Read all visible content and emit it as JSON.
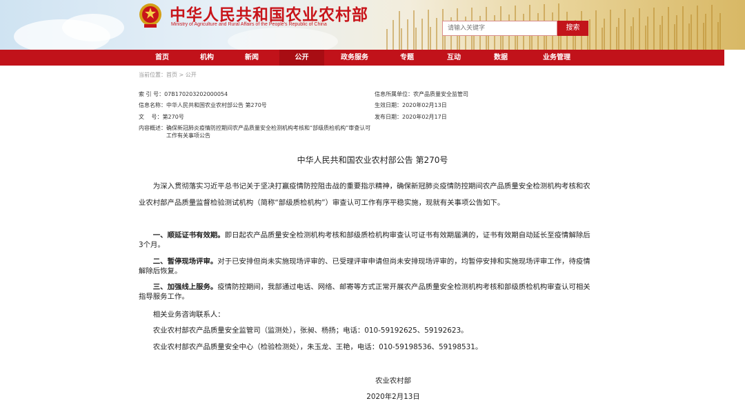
{
  "header": {
    "site_title": "中华人民共和国农业农村部",
    "site_subtitle": "Ministry of Agriculture and Rural Affairs of the People's Republic of China",
    "search_placeholder": "请输入关键字",
    "search_button": "搜索",
    "emblem_icon": "national-emblem-icon"
  },
  "nav": {
    "items": [
      "首页",
      "机构",
      "新闻",
      "公开",
      "政务服务",
      "专题",
      "互动",
      "数据",
      "业务管理"
    ],
    "active": "公开"
  },
  "breadcrumb": "当前位置：首页 > 公开",
  "meta": {
    "index_label": "索 引 号：",
    "index_value": "07B170203202000054",
    "name_label": "信息名称：",
    "name_value": "中华人民共和国农业农村部公告 第270号",
    "doc_no_label": "文　 号：",
    "doc_no_value": "第270号",
    "summary_label": "内容概述：",
    "summary_value": "确保新冠肺炎疫情防控期间农产品质量安全检测机构考核和“部级质检机构”审查认可工作有关事项公告",
    "unit_label": "信息所属单位：",
    "unit_value": "农产品质量安全监管司",
    "effective_label": "生效日期：",
    "effective_value": "2020年02月13日",
    "publish_label": "发布日期：",
    "publish_value": "2020年02月17日"
  },
  "article": {
    "title": "中华人民共和国农业农村部公告 第270号",
    "intro": "为深入贯彻落实习近平总书记关于坚决打赢疫情防控阻击战的重要指示精神，确保新冠肺炎疫情防控期间农产品质量安全检测机构考核和农业农村部产品质量监督检验测试机构（简称“部级质检机构”）审查认可工作有序平稳实施，现就有关事项公告如下。",
    "item1_bold": "一、顺延证书有效期。",
    "item1_text": "即日起农产品质量安全检测机构考核和部级质检机构审查认可证书有效期届满的，证书有效期自动延长至疫情解除后3个月。",
    "item2_bold": "二、暂停现场评审。",
    "item2_text": "对于已安排但尚未实施现场评审的、已受理评审申请但尚未安排现场评审的，均暂停安排和实施现场评审工作，待疫情解除后恢复。",
    "item3_bold": "三、加强线上服务。",
    "item3_text": "疫情防控期间，我部通过电话、网络、邮寄等方式正常开展农产品质量安全检测机构考核和部级质检机构审查认可相关指导服务工作。",
    "contacts_heading": "相关业务咨询联系人：",
    "contact1": "农业农村部农产品质量安全监管司（监测处），张昶、杨扬；电话：010-59192625、59192623。",
    "contact2": "农业农村部农产品质量安全中心（检验检测处），朱玉龙、王艳，电话：010-59198536、59198531。",
    "signature": "农业农村部",
    "date": "2020年2月13日"
  },
  "colors": {
    "brand_red": "#c1121a",
    "active_tab": "#a80d13"
  }
}
